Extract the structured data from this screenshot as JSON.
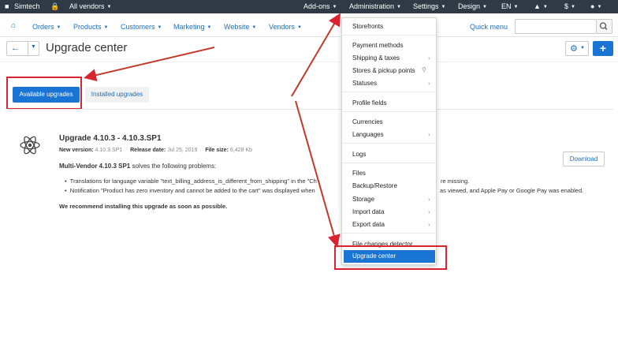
{
  "topbar": {
    "store_name": "Simtech",
    "vendors": "All vendors",
    "addons": "Add-ons",
    "administration": "Administration",
    "settings": "Settings",
    "design": "Design",
    "language": "EN",
    "currency": "$"
  },
  "nav": {
    "items": [
      "Orders",
      "Products",
      "Customers",
      "Marketing",
      "Website",
      "Vendors"
    ],
    "quick_menu": "Quick menu"
  },
  "page": {
    "title": "Upgrade center"
  },
  "tabs": {
    "available": "Available upgrades",
    "installed": "Installed upgrades"
  },
  "upgrade": {
    "title": "Upgrade 4.10.3 - 4.10.3.SP1",
    "new_version_label": "New version:",
    "new_version": "4.10.3.SP1",
    "release_date_label": "Release date:",
    "release_date": "Jul 25, 2019",
    "file_size_label": "File size:",
    "file_size": "6,428 Kb",
    "product_name": "Multi-Vendor 4.10.3 SP1",
    "description": " solves the following problems:",
    "bullet_1_a": "Translations for language variable \"text_billing_address_is_different_from_shipping\" in the \"Ch",
    "bullet_1_b": "re missing.",
    "bullet_2_a": "Notification \"Product has zero inventory and cannot be added to the cart\" was displayed when",
    "bullet_2_b": "as viewed, and Apple Pay or Google Pay was enabled.",
    "recommendation": "We recommend installing this upgrade as soon as possible.",
    "download": "Download"
  },
  "dropdown": {
    "storefronts": "Storefronts",
    "payment_methods": "Payment methods",
    "shipping_taxes": "Shipping & taxes",
    "stores_pickup": "Stores & pickup points",
    "statuses": "Statuses",
    "profile_fields": "Profile fields",
    "currencies": "Currencies",
    "languages": "Languages",
    "logs": "Logs",
    "files": "Files",
    "backup_restore": "Backup/Restore",
    "storage": "Storage",
    "import_data": "Import data",
    "export_data": "Export data",
    "file_changes_detector": "File changes detector",
    "upgrade_center": "Upgrade center"
  },
  "colors": {
    "topbar_bg": "#2f3a46",
    "accent_blue": "#1a74d3",
    "link_blue": "#1a6fbf",
    "annotation_red": "#d9232e"
  }
}
